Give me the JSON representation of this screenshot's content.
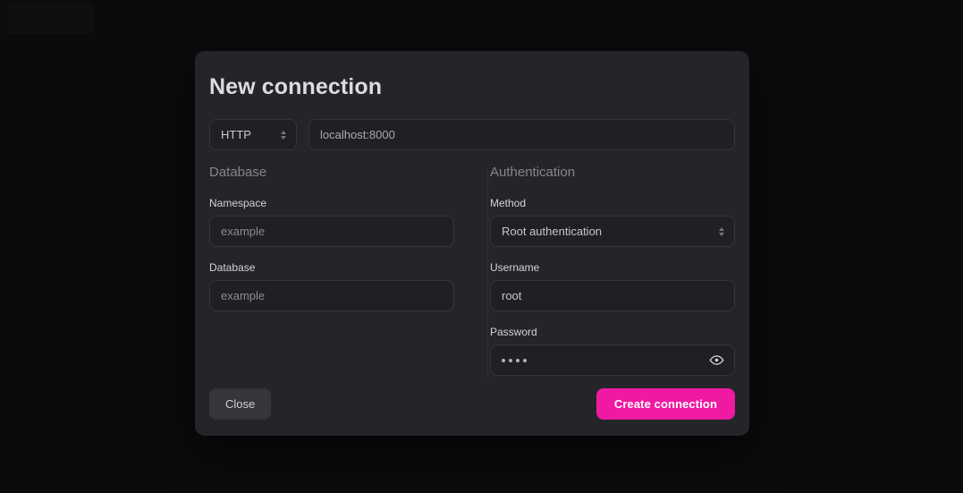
{
  "dialog": {
    "title": "New connection",
    "protocol": {
      "label": "protocol-select",
      "value": "HTTP",
      "options": [
        "HTTP"
      ]
    },
    "endpoint": {
      "value": "localhost:8000"
    },
    "database_section": {
      "heading": "Database",
      "fields": [
        {
          "label": "Namespace",
          "value": "example"
        },
        {
          "label": "Database",
          "value": "example"
        }
      ]
    },
    "authentication_section": {
      "heading": "Authentication",
      "method": {
        "label": "Method",
        "value": "Root authentication",
        "options": [
          "Root authentication"
        ]
      },
      "username": {
        "label": "Username",
        "value": "root"
      },
      "password": {
        "label": "Password",
        "value": "••••",
        "masked_char_count": 4,
        "reveal_icon": "eye-icon"
      }
    },
    "footer": {
      "close_label": "Close",
      "submit_label": "Create connection"
    }
  },
  "theme": {
    "page_background": "#0b0b0d",
    "dialog_background": "#242529",
    "field_background": "#1f2024",
    "field_border": "#35363b",
    "accent": "#ef19a2",
    "text_primary": "#dcdce0",
    "text_label": "#d2d2d7",
    "text_muted": "#86868d",
    "close_button_background": "#35363a"
  }
}
